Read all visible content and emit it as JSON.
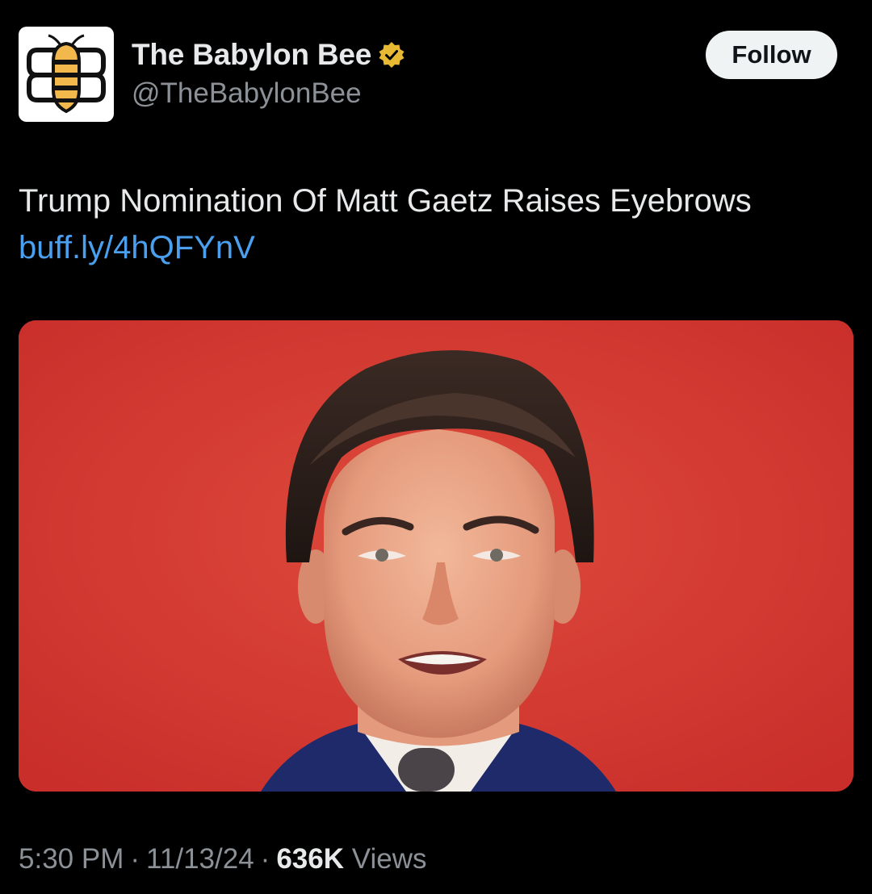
{
  "author": {
    "display_name": "The Babylon Bee",
    "handle": "@TheBabylonBee",
    "verified_badge_color": "#e8b932",
    "avatar_icon": "babylon-bee-logo-icon"
  },
  "follow_label": "Follow",
  "tweet": {
    "text": "Trump Nomination Of Matt Gaetz Raises Eyebrows",
    "link": "buff.ly/4hQFYnV",
    "link_color": "#4aa0ee"
  },
  "media": {
    "background_color": "#d73a33",
    "subject": "photo-portrait"
  },
  "meta": {
    "time": "5:30 PM",
    "date": "11/13/24",
    "separator": "·",
    "views_count": "636K",
    "views_label": "Views"
  }
}
